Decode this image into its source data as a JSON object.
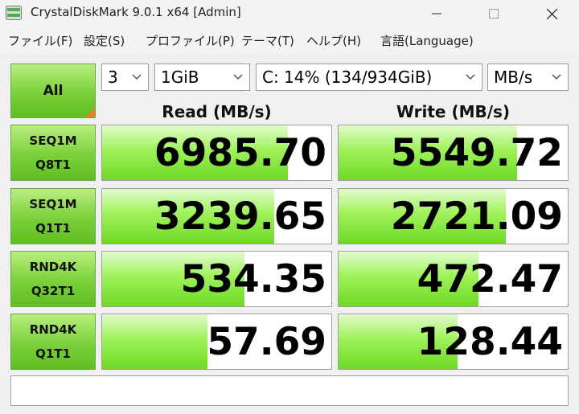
{
  "window": {
    "title": "CrystalDiskMark 9.0.1 x64 [Admin]"
  },
  "menu": [
    "ファイル(F)",
    "設定(S)",
    "プロファイル(P)",
    "テーマ(T)",
    "ヘルプ(H)",
    "言語(Language)"
  ],
  "controls": {
    "all_label": "All",
    "count": "3",
    "size": "1GiB",
    "drive": "C: 14% (134/934GiB)",
    "unit": "MB/s"
  },
  "headers": {
    "read": "Read (MB/s)",
    "write": "Write (MB/s)"
  },
  "tests": [
    {
      "line1": "SEQ1M",
      "line2": "Q8T1",
      "read": "6985.70",
      "write": "5549.72",
      "read_fill": 0.81,
      "write_fill": 0.78
    },
    {
      "line1": "SEQ1M",
      "line2": "Q1T1",
      "read": "3239.65",
      "write": "2721.09",
      "read_fill": 0.75,
      "write_fill": 0.73
    },
    {
      "line1": "RND4K",
      "line2": "Q32T1",
      "read": "534.35",
      "write": "472.47",
      "read_fill": 0.62,
      "write_fill": 0.61
    },
    {
      "line1": "RND4K",
      "line2": "Q1T1",
      "read": "57.69",
      "write": "128.44",
      "read_fill": 0.46,
      "write_fill": 0.52
    }
  ],
  "status": ""
}
